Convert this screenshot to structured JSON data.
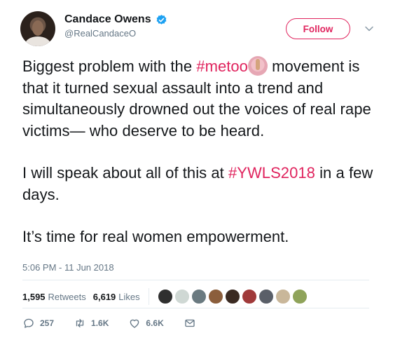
{
  "tweet": {
    "display_name": "Candace Owens",
    "handle": "@RealCandaceO",
    "verified_icon": "verified-badge-icon",
    "follow_label": "Follow",
    "text": {
      "p1_a": "Biggest problem with the ",
      "p1_hashtag": "#metoo",
      "p1_b": "movement is that it turned sexual assault into a trend and simultaneously drowned out the voices of real rape victims— who deserve to be heard.",
      "p2_a": "I will speak about all of this at ",
      "p2_hashtag": "#YWLS2018",
      "p2_b": " in a few days.",
      "p3": "It’s time for real women empowerment."
    },
    "timestamp": "5:06 PM - 11 Jun 2018",
    "stats": {
      "retweets_count": "1,595",
      "retweets_label": "Retweets",
      "likes_count": "6,619",
      "likes_label": "Likes"
    },
    "actions": {
      "replies": "257",
      "retweets": "1.6K",
      "likes": "6.6K"
    }
  },
  "colors": {
    "accent": "#e0245e",
    "secondary_text": "#657786",
    "verified": "#1da1f2"
  }
}
